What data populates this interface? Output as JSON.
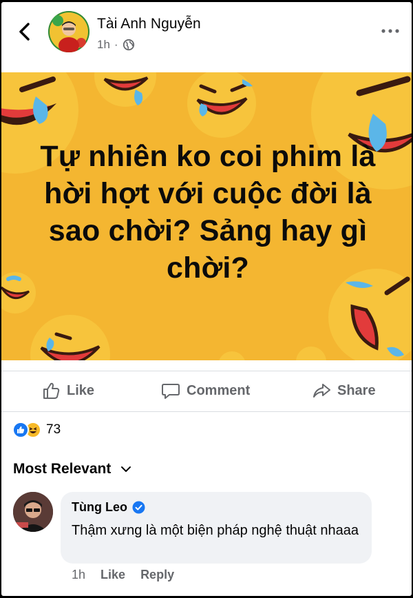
{
  "post": {
    "author_name": "Tài Anh Nguyễn",
    "timestamp": "1h",
    "privacy_icon": "globe-icon",
    "caption_lines": [
      "Tự nhiên ko coi phim là",
      "hời hợt với cuộc đời là",
      "sao chời? Sảng hay gì",
      "chời?"
    ],
    "image_background_color": "#f4b631"
  },
  "actions": {
    "like_label": "Like",
    "comment_label": "Comment",
    "share_label": "Share"
  },
  "reactions": {
    "types": [
      "like",
      "haha"
    ],
    "count": "73"
  },
  "comments_filter": {
    "label": "Most Relevant"
  },
  "comment": {
    "author_name": "Tùng Leo",
    "verified": true,
    "text": "Thậm xưng là một biện pháp nghệ thuật nhaaa",
    "timestamp": "1h",
    "like_label": "Like",
    "reply_label": "Reply"
  },
  "colors": {
    "facebook_blue": "#1877f2",
    "secondary_text": "#65676b",
    "bubble_bg": "#f0f2f5"
  }
}
